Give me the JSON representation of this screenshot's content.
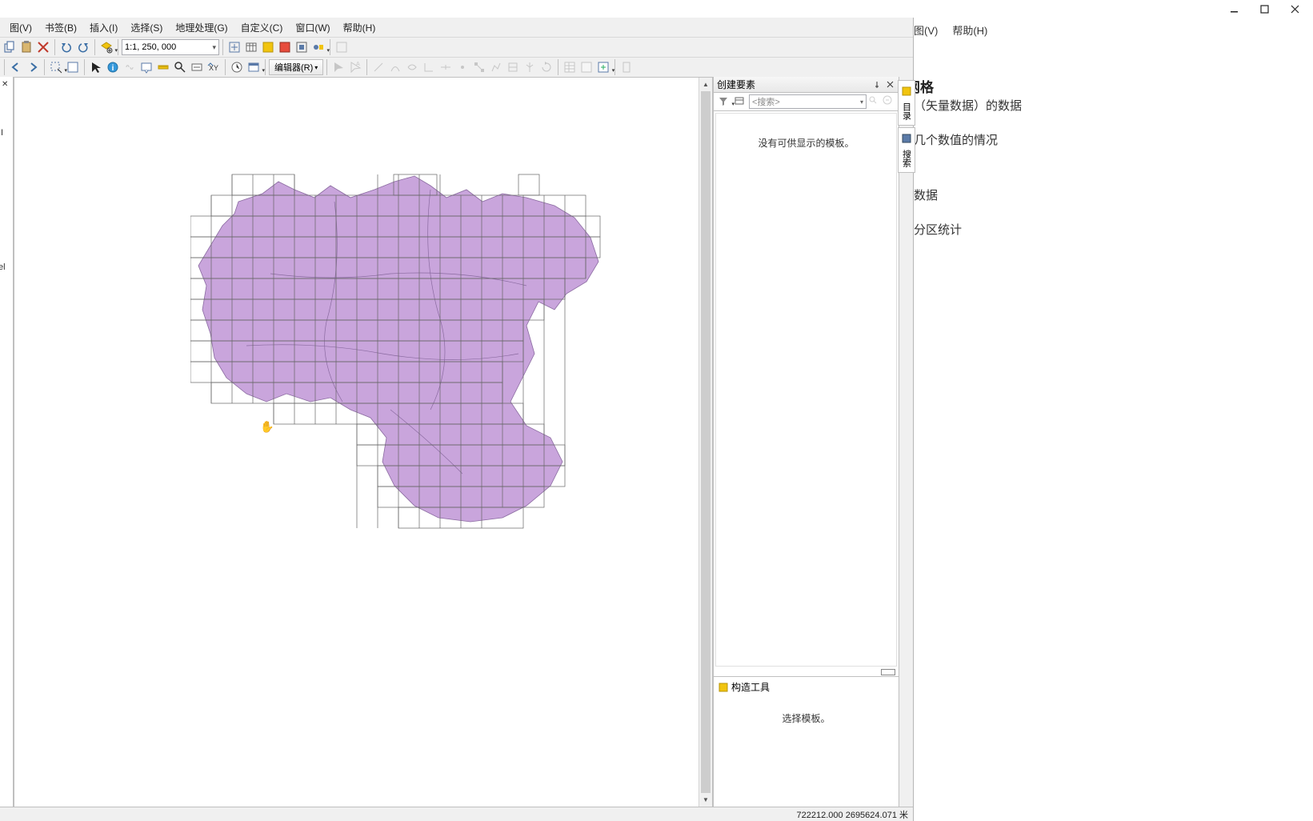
{
  "bg": {
    "menu": {
      "view": "图(V)",
      "help": "帮助(H)"
    },
    "title_suffix": "网格",
    "lines": [
      "（矢量数据）的数据",
      "几个数值的情况",
      "数据",
      "分区统计"
    ]
  },
  "menu": {
    "view": "图(V)",
    "bookmarks": "书签(B)",
    "insert": "插入(I)",
    "selection": "选择(S)",
    "geoprocessing": "地理处理(G)",
    "customize": "自定义(C)",
    "window": "窗口(W)",
    "help": "帮助(H)"
  },
  "toolbar": {
    "scale": "1:1, 250, 000",
    "editor_label": "编辑器(R)"
  },
  "left": {
    "layer_char": "I",
    "ext": "el"
  },
  "panel": {
    "title": "创建要素",
    "search_placeholder": "<搜索>",
    "empty_msg": "没有可供显示的模板。",
    "section_title": "构造工具",
    "section_msg": "选择模板。"
  },
  "vtabs": {
    "tab1": "目录",
    "tab2": "搜索"
  },
  "status": {
    "coords": "722212.000  2695624.071 米"
  }
}
